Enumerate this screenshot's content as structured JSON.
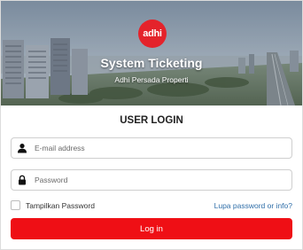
{
  "hero": {
    "logo_text": "adhi",
    "title": "System Ticketing",
    "subtitle": "Adhi Persada Properti",
    "background": "city-aerial-photo"
  },
  "login": {
    "heading": "USER LOGIN",
    "email_placeholder": "E-mail address",
    "password_placeholder": "Password",
    "email_icon": "user-icon",
    "password_icon": "lock-icon",
    "show_password_label": "Tampilkan Password",
    "show_password_checked": false,
    "forgot_link": "Lupa password or info?",
    "submit_label": "Log in"
  },
  "colors": {
    "brand_red": "#ef0f15",
    "logo_red": "#e4232b",
    "link_blue": "#2f6ea8"
  }
}
